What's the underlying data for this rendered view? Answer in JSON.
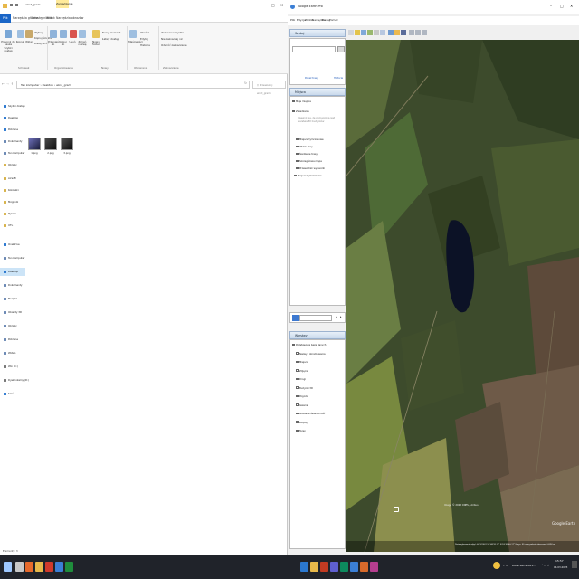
{
  "explorer": {
    "title": "wind_gram",
    "tabs": [
      "Plik",
      "Narzędzia główne",
      "Udostępnianie",
      "Widok",
      "Narzędzia obrazów"
    ],
    "tab_highlight": "Zarządzanie",
    "ribbon": {
      "buttons": [
        "Przypnij do paska Szybki dostęp",
        "Kopiuj",
        "Wklej",
        "Przenieś do",
        "Kopiuj do",
        "Usuń",
        "Zmień nazwę",
        "Nowy folder",
        "Właściwości",
        "Otwórz",
        "Zaznacz wszystko",
        "Nie zaznaczaj nic",
        "Odwróć zaznaczenie"
      ],
      "small": [
        "Wytnij",
        "Kopiuj ścieżkę",
        "Wklej skrót",
        "Nowy element",
        "Łatwy dostęp",
        "Edytuj",
        "Historia"
      ],
      "groups": [
        "Schowek",
        "Organizowanie",
        "Nowy",
        "Otwieranie",
        "Zaznaczanie"
      ]
    },
    "address": {
      "path": [
        "Ten komputer",
        "Desktop",
        "wind_gram"
      ],
      "search_placeholder": "Przeszukaj: wind_gram"
    },
    "nav": {
      "items": [
        {
          "label": "Szybki dostęp",
          "color": "#2b78d0"
        },
        {
          "label": "Desktop",
          "color": "#2b78d0"
        },
        {
          "label": "Pobrane",
          "color": "#2b78d0"
        },
        {
          "label": "Dokumenty",
          "color": "#6b88b4"
        },
        {
          "label": "Ten komputer",
          "color": "#6b88b4"
        },
        {
          "label": "Obrazy",
          "color": "#d7b24a"
        },
        {
          "label": "Airsoft",
          "color": "#d7b24a"
        },
        {
          "label": "Kokoszki",
          "color": "#d7b24a"
        },
        {
          "label": "Mogilnik",
          "color": "#d7b24a"
        },
        {
          "label": "Pyknoi",
          "color": "#d7b24a"
        },
        {
          "label": "UTL",
          "color": "#d7b24a"
        },
        {
          "label": "OneDrive",
          "color": "#2b78d0"
        },
        {
          "label": "Ten komputer",
          "color": "#6b88b4"
        },
        {
          "label": "Desktop",
          "color": "#2b78d0"
        },
        {
          "label": "Dokumenty",
          "color": "#6b88b4"
        },
        {
          "label": "Muzyka",
          "color": "#6b88b4"
        },
        {
          "label": "Obiekty 3D",
          "color": "#6b88b4"
        },
        {
          "label": "Obrazy",
          "color": "#6b88b4"
        },
        {
          "label": "Pobrane",
          "color": "#6b88b4"
        },
        {
          "label": "Wideo",
          "color": "#6b88b4"
        },
        {
          "label": "Win (C:)",
          "color": "#777777"
        },
        {
          "label": "Dysk lokalny (D:)",
          "color": "#777777"
        },
        {
          "label": "Sieć",
          "color": "#2b78d0"
        }
      ],
      "selected_index": 13
    },
    "files": [
      {
        "name": "1.png"
      },
      {
        "name": "2.png"
      },
      {
        "name": "3.png"
      }
    ],
    "status": "Elementy: 3"
  },
  "earth": {
    "title": "Google Earth Pro",
    "menu": [
      "Plik",
      "Edycja",
      "Widok",
      "Narzędzia",
      "Dodaj",
      "Pomoc"
    ],
    "search_head": "Szukaj",
    "search_links": [
      "Pokaż trasy",
      "Historia"
    ],
    "places_head": "Miejsca",
    "places": [
      "Moje miejsca",
      "Zwiedzanie",
      "Upewnij się, że zaznaczona jest warstwa 3D budynków",
      "Miejsce tymczasowe",
      "Widok ulicy",
      "Śledzenie trasy",
      "Szczegółowa mapa",
      "Przewodnik wycieczki",
      "Miejsca tymczasowe"
    ],
    "layers_head": "Warstwy",
    "layers": [
      "Podstawowa baza danych",
      "Nazwy i obramowania",
      "Miejsca",
      "Zdjęcia",
      "Drogi",
      "Budynki 3D",
      "Pogoda",
      "Galeria",
      "Globalna świadomość",
      "Więcej",
      "Teren"
    ],
    "map_credit": "Image © 2022 CNES / Airbus",
    "logo": "Google Earth",
    "status_bar": "Data wykonania zdjęć: 4/21/2022   52°48'32.13\" N  18°09'46.17\" E   wys. 95 m   wysokość obserwacji 4.89 km"
  },
  "taskbar": {
    "weather_temp": "7°C",
    "weather_text": "Duże zachmurz...",
    "time": "15:57",
    "date": "04.03.2023"
  }
}
